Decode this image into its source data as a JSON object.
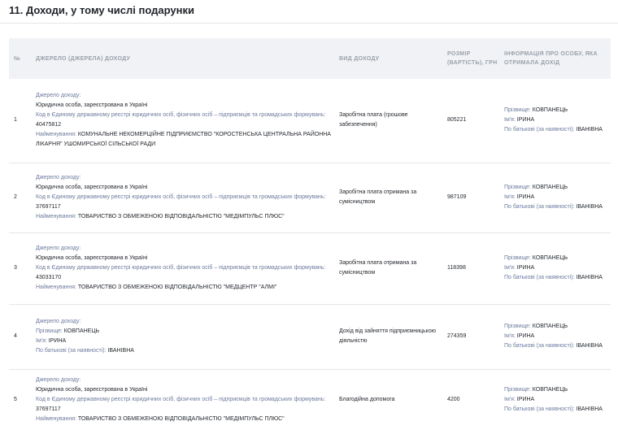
{
  "section_title": "11. Доходи, у тому числі подарунки",
  "headers": {
    "num": "№",
    "source": "ДЖЕРЕЛО (ДЖЕРЕЛА) ДОХОДУ",
    "type": "ВИД ДОХОДУ",
    "amount": "РОЗМІР (ВАРТІСТЬ), ГРН",
    "person": "ІНФОРМАЦІЯ ПРО ОСОБУ, ЯКА ОТРИМАЛА ДОХІД"
  },
  "labels": {
    "source": "Джерело доходу:",
    "legal_entity": "Юридична особа, зареєстрована в Україні",
    "edrpou": "Код в Єдиному державному реєстрі юридичних осіб, фізичних осіб – підприємців та громадських формувань:",
    "name": "Найменування:",
    "surname": "Прізвище:",
    "first_name": "Ім'я:",
    "patronymic": "По батькові (за наявності):"
  },
  "rows": [
    {
      "num": "1",
      "code": "40475812",
      "org": "КОМУНАЛЬНЕ НЕКОМЕРЦІЙНЕ ПІДПРИЄМСТВО \"КОРОСТЕНСЬКА ЦЕНТРАЛЬНА РАЙОННА ЛІКАРНЯ\" УШОМИРСЬКОЇ СІЛЬСЬКОЇ РАДИ",
      "type": "Заробітна плата (грошове забезпечення)",
      "amount": "805221",
      "surname": "КОВПАНЕЦЬ",
      "first_name": "ІРИНА",
      "patronymic": "ІВАНІВНА"
    },
    {
      "num": "2",
      "code": "37697117",
      "org": "ТОВАРИСТВО З ОБМЕЖЕНОЮ ВІДПОВІДАЛЬНІСТЮ \"МЕДІМПУЛЬС ПЛЮС\"",
      "type": "Заробітна плата отримана за сумісництвом",
      "amount": "987109",
      "surname": "КОВПАНЕЦЬ",
      "first_name": "ІРИНА",
      "patronymic": "ІВАНІВНА"
    },
    {
      "num": "3",
      "code": "43033170",
      "org": "ТОВАРИСТВО З ОБМЕЖЕНОЮ ВІДПОВІДАЛЬНІСТЮ \"МЕДЦЕНТР \"АЛМІ\"",
      "type": "Заробітна плата отримана за сумісництвом",
      "amount": "118398",
      "surname": "КОВПАНЕЦЬ",
      "first_name": "ІРИНА",
      "patronymic": "ІВАНІВНА"
    },
    {
      "num": "4",
      "src_surname": "КОВПАНЕЦЬ",
      "src_first_name": "ІРИНА",
      "src_patronymic": "ІВАНІВНА",
      "type": "Дохід від зайняття підприємницькою діяльністю",
      "amount": "274359",
      "surname": "КОВПАНЕЦЬ",
      "first_name": "ІРИНА",
      "patronymic": "ІВАНІВНА"
    },
    {
      "num": "5",
      "code": "37697117",
      "org": "ТОВАРИСТВО З ОБМЕЖЕНОЮ ВІДПОВІДАЛЬНІСТЮ \"МЕДІМПУЛЬС ПЛЮС\"",
      "type": "Благодійна допомога",
      "amount": "4200",
      "surname": "КОВПАНЕЦЬ",
      "first_name": "ІРИНА",
      "patronymic": "ІВАНІВНА"
    }
  ]
}
